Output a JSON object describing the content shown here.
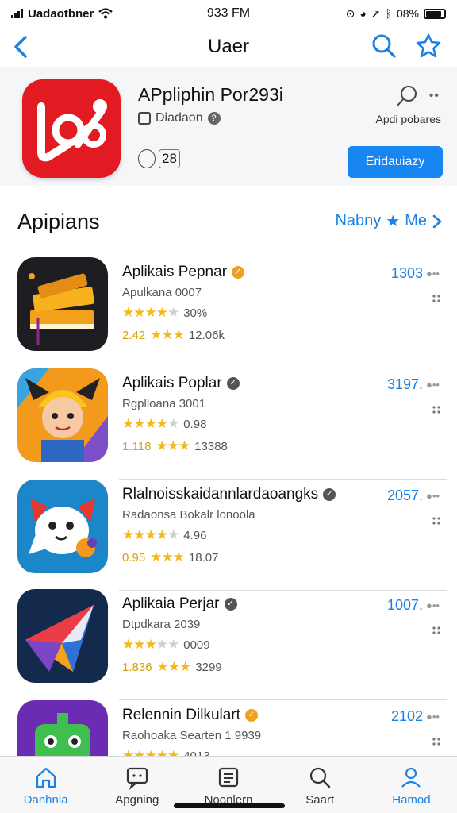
{
  "status": {
    "carrier": "Uadaotbner",
    "time": "933 FM",
    "battery": "08%",
    "battery_level": 0.85
  },
  "nav": {
    "title": "Uaer"
  },
  "featured": {
    "title": "APpliphin Por293i",
    "subtitle": "Diadaon",
    "count": "28",
    "side_label": "Apdi pobares",
    "button": "Eridauiazy",
    "icon_color": "#e21b22"
  },
  "section": {
    "title": "Apipians",
    "link": "Nabny",
    "link_tail": "Me"
  },
  "apps": [
    {
      "name": "Aplikais Pepnar",
      "badge_color": "#f0a020",
      "subtitle": "Apulkana 0007",
      "stars": 4,
      "rating_text": "30%",
      "lead": "2.42",
      "small_stars": 3,
      "count": "12.06k",
      "price": "1303",
      "icon": "books"
    },
    {
      "name": "Aplikais Poplar",
      "badge_color": "#555555",
      "subtitle": "Rgplloana 3001",
      "stars": 4,
      "rating_text": "0.98",
      "lead": "1.118",
      "small_stars": 3,
      "count": "13388",
      "price": "3197.",
      "icon": "boy"
    },
    {
      "name": "Rlalnoisskaidannlardaoangks",
      "badge_color": "#555555",
      "subtitle": "Radaonsa Bokalr lonoola",
      "stars": 4,
      "rating_text": "4.96",
      "lead": "0.95",
      "small_stars": 3,
      "count": "18.07",
      "price": "2057.",
      "icon": "fox"
    },
    {
      "name": "Aplikaia Perjar",
      "badge_color": "#555555",
      "subtitle": "Dtpdkara 2039",
      "stars": 3,
      "rating_text": "0009",
      "lead": "1.836",
      "small_stars": 3,
      "count": "3299",
      "price": "1007.",
      "icon": "paper"
    },
    {
      "name": "Relennin Dilkulart",
      "badge_color": "#f0a020",
      "subtitle": "Raohoaka Searten 1 9939",
      "stars": 5,
      "rating_text": "4013",
      "lead": "",
      "small_stars": 0,
      "count": "",
      "price": "2102",
      "icon": "robot"
    }
  ],
  "tabs": [
    {
      "label": "Danhnia",
      "icon": "home-icon",
      "active": true
    },
    {
      "label": "Apgning",
      "icon": "chat-icon",
      "active": false
    },
    {
      "label": "Noonlern",
      "icon": "list-icon",
      "active": false
    },
    {
      "label": "Saart",
      "icon": "search-icon",
      "active": false
    },
    {
      "label": "Hamod",
      "icon": "profile-icon",
      "active": true
    }
  ]
}
